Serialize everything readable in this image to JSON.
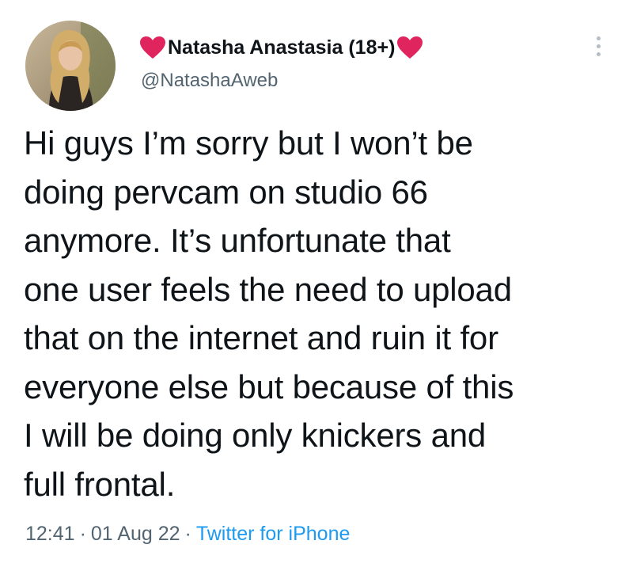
{
  "author": {
    "heart_left": "❤",
    "display_name": "Natasha Anastasia (18+)",
    "heart_right": "❤",
    "handle": "@NatashaAweb",
    "avatar_icon": "profile-photo"
  },
  "more_icon": "vertical-ellipsis-icon",
  "tweet": {
    "lines": [
      "Hi guys I’m sorry but I won’t be",
      "doing pervcam on studio 66",
      "anymore. It’s unfortunate that",
      "one user feels the need to upload",
      "that on the internet and ruin it for",
      "everyone else but because of this",
      "I will be doing only knickers and",
      "full frontal."
    ]
  },
  "meta": {
    "time": "12:41",
    "separator": "·",
    "date": "01 Aug 22",
    "source": "Twitter for iPhone"
  },
  "colors": {
    "text": "#0f1419",
    "secondary": "#536471",
    "link": "#1d9bf0",
    "heart": "#e0245e"
  }
}
